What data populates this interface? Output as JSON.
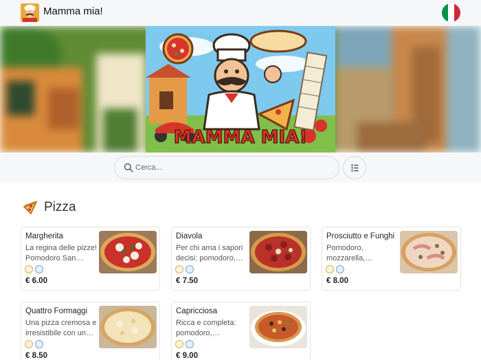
{
  "header": {
    "brand": "Mamma mia!",
    "logo_icon": "chef-logo-icon",
    "language_icon": "italian-flag-icon"
  },
  "banner": {
    "hero_text": "MAMMA MIA!"
  },
  "search": {
    "placeholder": "Cerca...",
    "icon": "search-icon",
    "list_button_icon": "list-icon"
  },
  "section": {
    "title": "Pizza",
    "icon": "pizza-slice-icon"
  },
  "items": [
    {
      "name": "Margherita",
      "description": "La regina delle pizze! Pomodoro San…",
      "price": "€ 6.00"
    },
    {
      "name": "Diavola",
      "description": "Per chi ama i sapori decisi: pomodoro,…",
      "price": "€ 7.50"
    },
    {
      "name": "Prosciutto e Funghi",
      "description": "Pomodoro, mozzarella,…",
      "price": "€ 8.00"
    },
    {
      "name": "Quattro Formaggi",
      "description": "Una pizza cremosa e irresistibile con un…",
      "price": "€ 8.50"
    },
    {
      "name": "Capricciosa",
      "description": "Ricca e completa: pomodoro,…",
      "price": "€ 9.00"
    }
  ],
  "allergen_icons": [
    "gluten-icon",
    "dairy-icon"
  ],
  "colors": {
    "flag_green": "#009246",
    "flag_white": "#ffffff",
    "flag_red": "#ce2b37",
    "hero_red": "#d8342a",
    "hero_sky": "#7ec9ee"
  }
}
